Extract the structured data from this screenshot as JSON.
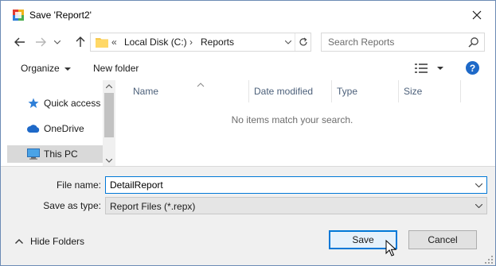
{
  "window": {
    "title": "Save 'Report2'",
    "app_icon": "report-app-icon",
    "close_icon": "close-icon"
  },
  "address_bar": {
    "overflow_chevron": "«",
    "crumbs": [
      "Local Disk (C:)",
      "Reports"
    ],
    "separator": "›",
    "folder_icon": "folder-icon"
  },
  "search": {
    "placeholder": "Search Reports"
  },
  "commands": {
    "organize": "Organize",
    "new_folder": "New folder",
    "help": "?"
  },
  "nav_pane": {
    "items": [
      {
        "label": "Quick access",
        "icon": "star-icon",
        "selected": false
      },
      {
        "label": "OneDrive",
        "icon": "cloud-icon",
        "selected": false
      },
      {
        "label": "This PC",
        "icon": "computer-icon",
        "selected": true
      }
    ]
  },
  "file_list": {
    "columns": [
      "Name",
      "Date modified",
      "Type",
      "Size"
    ],
    "empty_message": "No items match your search."
  },
  "form": {
    "file_name_label": "File name:",
    "file_name_value": "DetailReport",
    "save_type_label": "Save as type:",
    "save_type_value": "Report Files (*.repx)"
  },
  "footer": {
    "hide_folders": "Hide Folders",
    "save": "Save",
    "cancel": "Cancel"
  },
  "colors": {
    "accent": "#0078d7",
    "help": "#1e69c8",
    "panel": "#f0f0f0"
  }
}
